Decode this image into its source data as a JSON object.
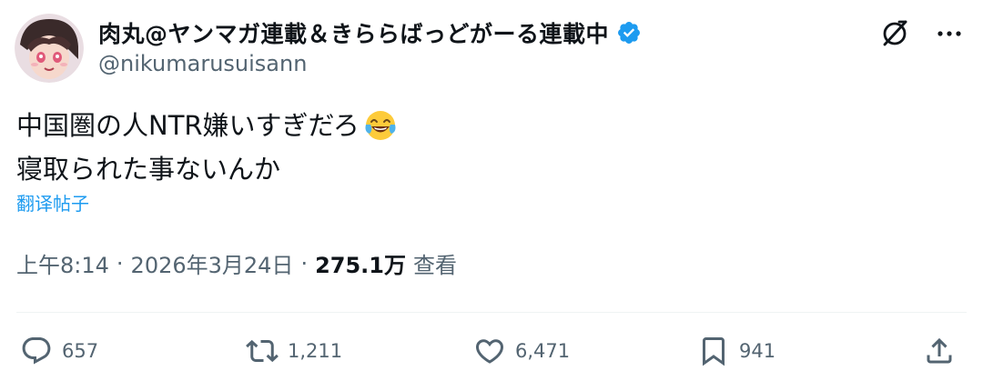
{
  "author": {
    "display_name": "肉丸@ヤンマガ連載＆きららばっどがーる連載中",
    "handle": "@nikumarusuisann",
    "verified": true,
    "verified_color": "#1d9bf0"
  },
  "tweet": {
    "lines": [
      "中国圏の人NTR嫌いすぎだろ",
      "寝取られた事ないんか"
    ],
    "emoji": "face-with-tears-of-joy"
  },
  "translate_label": "翻译帖子",
  "meta": {
    "time": "上午8:14",
    "separator": "·",
    "date": "2026年3月24日",
    "views_count": "275.1万",
    "views_label": "查看"
  },
  "actions": {
    "replies": "657",
    "reposts": "1,211",
    "likes": "6,471",
    "bookmarks": "941"
  },
  "icons": {
    "grok": "grok-icon",
    "more": "more-icon",
    "reply": "reply-icon",
    "repost": "repost-icon",
    "like": "heart-icon",
    "bookmark": "bookmark-icon",
    "share": "share-icon"
  },
  "colors": {
    "text": "#0f1419",
    "muted": "#536471",
    "link": "#1d9bf0",
    "divider": "#eff3f4"
  }
}
